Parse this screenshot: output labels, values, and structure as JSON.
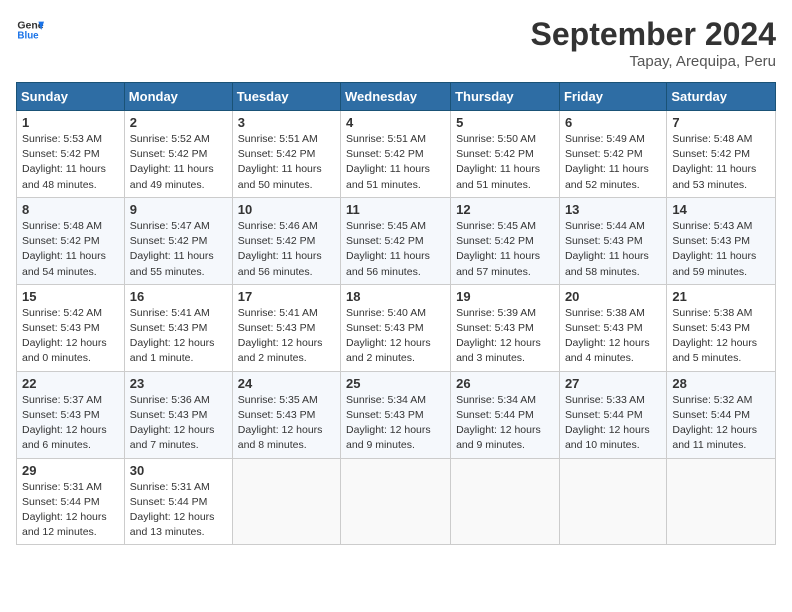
{
  "header": {
    "logo_line1": "General",
    "logo_line2": "Blue",
    "month": "September 2024",
    "location": "Tapay, Arequipa, Peru"
  },
  "weekdays": [
    "Sunday",
    "Monday",
    "Tuesday",
    "Wednesday",
    "Thursday",
    "Friday",
    "Saturday"
  ],
  "weeks": [
    [
      {
        "day": "1",
        "sunrise": "5:53 AM",
        "sunset": "5:42 PM",
        "daylight": "11 hours and 48 minutes."
      },
      {
        "day": "2",
        "sunrise": "5:52 AM",
        "sunset": "5:42 PM",
        "daylight": "11 hours and 49 minutes."
      },
      {
        "day": "3",
        "sunrise": "5:51 AM",
        "sunset": "5:42 PM",
        "daylight": "11 hours and 50 minutes."
      },
      {
        "day": "4",
        "sunrise": "5:51 AM",
        "sunset": "5:42 PM",
        "daylight": "11 hours and 51 minutes."
      },
      {
        "day": "5",
        "sunrise": "5:50 AM",
        "sunset": "5:42 PM",
        "daylight": "11 hours and 51 minutes."
      },
      {
        "day": "6",
        "sunrise": "5:49 AM",
        "sunset": "5:42 PM",
        "daylight": "11 hours and 52 minutes."
      },
      {
        "day": "7",
        "sunrise": "5:48 AM",
        "sunset": "5:42 PM",
        "daylight": "11 hours and 53 minutes."
      }
    ],
    [
      {
        "day": "8",
        "sunrise": "5:48 AM",
        "sunset": "5:42 PM",
        "daylight": "11 hours and 54 minutes."
      },
      {
        "day": "9",
        "sunrise": "5:47 AM",
        "sunset": "5:42 PM",
        "daylight": "11 hours and 55 minutes."
      },
      {
        "day": "10",
        "sunrise": "5:46 AM",
        "sunset": "5:42 PM",
        "daylight": "11 hours and 56 minutes."
      },
      {
        "day": "11",
        "sunrise": "5:45 AM",
        "sunset": "5:42 PM",
        "daylight": "11 hours and 56 minutes."
      },
      {
        "day": "12",
        "sunrise": "5:45 AM",
        "sunset": "5:42 PM",
        "daylight": "11 hours and 57 minutes."
      },
      {
        "day": "13",
        "sunrise": "5:44 AM",
        "sunset": "5:43 PM",
        "daylight": "11 hours and 58 minutes."
      },
      {
        "day": "14",
        "sunrise": "5:43 AM",
        "sunset": "5:43 PM",
        "daylight": "11 hours and 59 minutes."
      }
    ],
    [
      {
        "day": "15",
        "sunrise": "5:42 AM",
        "sunset": "5:43 PM",
        "daylight": "12 hours and 0 minutes."
      },
      {
        "day": "16",
        "sunrise": "5:41 AM",
        "sunset": "5:43 PM",
        "daylight": "12 hours and 1 minute."
      },
      {
        "day": "17",
        "sunrise": "5:41 AM",
        "sunset": "5:43 PM",
        "daylight": "12 hours and 2 minutes."
      },
      {
        "day": "18",
        "sunrise": "5:40 AM",
        "sunset": "5:43 PM",
        "daylight": "12 hours and 2 minutes."
      },
      {
        "day": "19",
        "sunrise": "5:39 AM",
        "sunset": "5:43 PM",
        "daylight": "12 hours and 3 minutes."
      },
      {
        "day": "20",
        "sunrise": "5:38 AM",
        "sunset": "5:43 PM",
        "daylight": "12 hours and 4 minutes."
      },
      {
        "day": "21",
        "sunrise": "5:38 AM",
        "sunset": "5:43 PM",
        "daylight": "12 hours and 5 minutes."
      }
    ],
    [
      {
        "day": "22",
        "sunrise": "5:37 AM",
        "sunset": "5:43 PM",
        "daylight": "12 hours and 6 minutes."
      },
      {
        "day": "23",
        "sunrise": "5:36 AM",
        "sunset": "5:43 PM",
        "daylight": "12 hours and 7 minutes."
      },
      {
        "day": "24",
        "sunrise": "5:35 AM",
        "sunset": "5:43 PM",
        "daylight": "12 hours and 8 minutes."
      },
      {
        "day": "25",
        "sunrise": "5:34 AM",
        "sunset": "5:43 PM",
        "daylight": "12 hours and 9 minutes."
      },
      {
        "day": "26",
        "sunrise": "5:34 AM",
        "sunset": "5:44 PM",
        "daylight": "12 hours and 9 minutes."
      },
      {
        "day": "27",
        "sunrise": "5:33 AM",
        "sunset": "5:44 PM",
        "daylight": "12 hours and 10 minutes."
      },
      {
        "day": "28",
        "sunrise": "5:32 AM",
        "sunset": "5:44 PM",
        "daylight": "12 hours and 11 minutes."
      }
    ],
    [
      {
        "day": "29",
        "sunrise": "5:31 AM",
        "sunset": "5:44 PM",
        "daylight": "12 hours and 12 minutes."
      },
      {
        "day": "30",
        "sunrise": "5:31 AM",
        "sunset": "5:44 PM",
        "daylight": "12 hours and 13 minutes."
      },
      null,
      null,
      null,
      null,
      null
    ]
  ]
}
